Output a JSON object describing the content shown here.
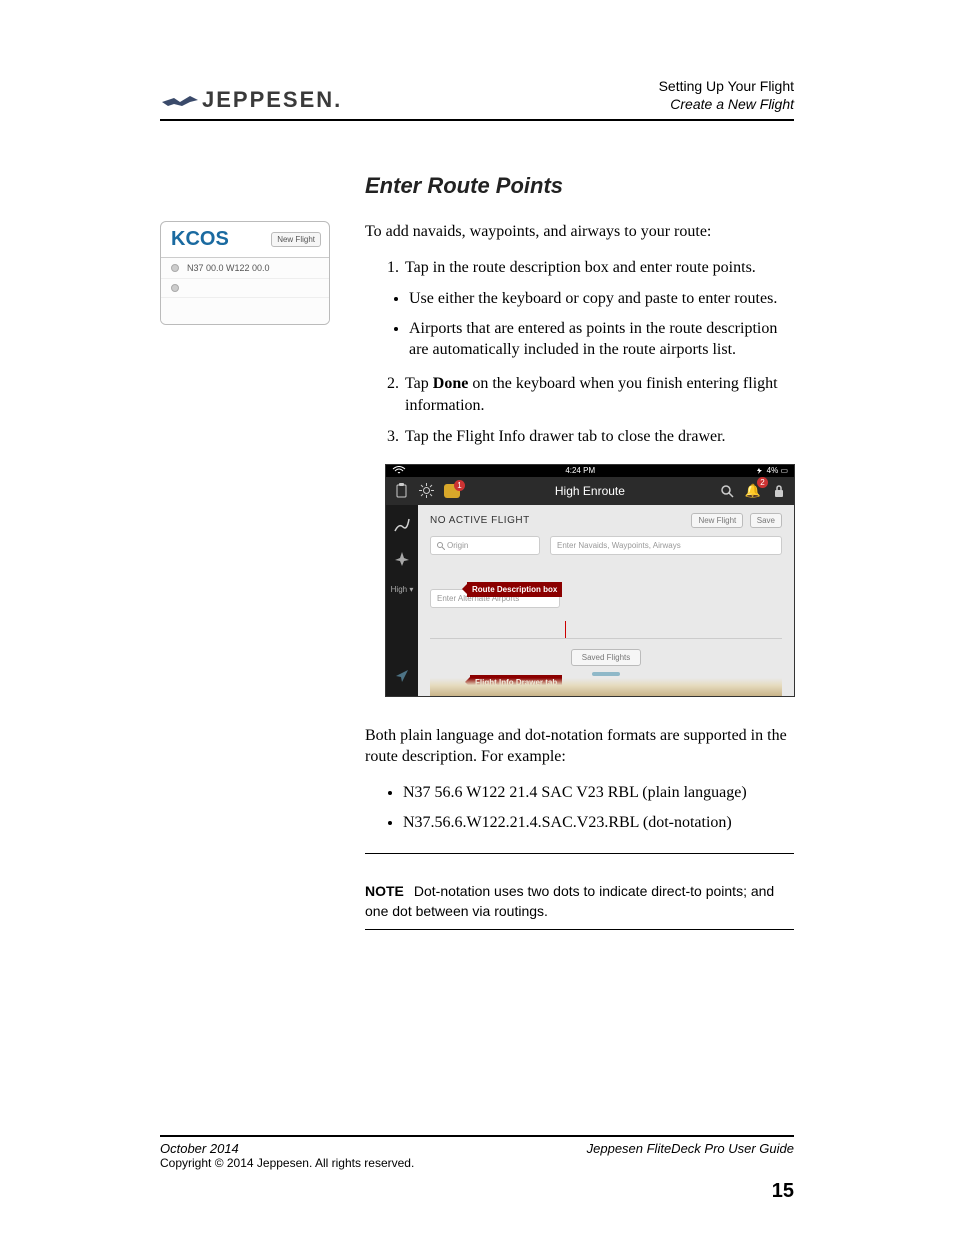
{
  "header": {
    "line1": "Setting Up Your Flight",
    "line2": "Create a New Flight",
    "logo_text": "JEPPESEN."
  },
  "section_title": "Enter Route Points",
  "intro": "To add navaids, waypoints, and airways to your route:",
  "steps": {
    "s1": "Tap in the route description box and enter route points.",
    "s1_bullets": {
      "b1": "Use either the keyboard or copy and paste to enter routes.",
      "b2": "Airports that are entered as points in the route description are automatically included in the route airports list."
    },
    "s2_pre": "Tap ",
    "s2_bold": "Done",
    "s2_post": " on the keyboard when you finish entering flight information.",
    "s3": "Tap the Flight Info drawer tab to close the drawer."
  },
  "post_fig": "Both plain language and dot-notation formats are supported in the route description. For example:",
  "examples": {
    "e1": "N37 56.6 W122 21.4 SAC V23 RBL (plain language)",
    "e2": "N37.56.6.W122.21.4.SAC.V23.RBL (dot-notation)"
  },
  "note": {
    "label": "NOTE",
    "text": "Dot-notation uses two dots to indicate direct-to points; and one dot between via routings."
  },
  "thumb": {
    "title": "KCOS",
    "button": "New Flight",
    "row1": "N37 00.0 W122 00.0"
  },
  "app": {
    "time": "4:24 PM",
    "battery": "4%",
    "title": "High Enroute",
    "no_active": "NO ACTIVE FLIGHT",
    "new_flight": "New Flight",
    "save": "Save",
    "origin_placeholder": "Origin",
    "route_placeholder": "Enter Navaids, Waypoints, Airways",
    "alt_placeholder": "Enter Alternate Airports",
    "saved_flights": "Saved Flights",
    "side_high": "High ▾",
    "callout_route": "Route Description box",
    "callout_drawer": "Flight Info Drawer tab"
  },
  "footer": {
    "left": "October 2014",
    "right": "Jeppesen FliteDeck Pro User Guide",
    "copyright": "Copyright © 2014 Jeppesen. All rights reserved.",
    "page": "15"
  }
}
